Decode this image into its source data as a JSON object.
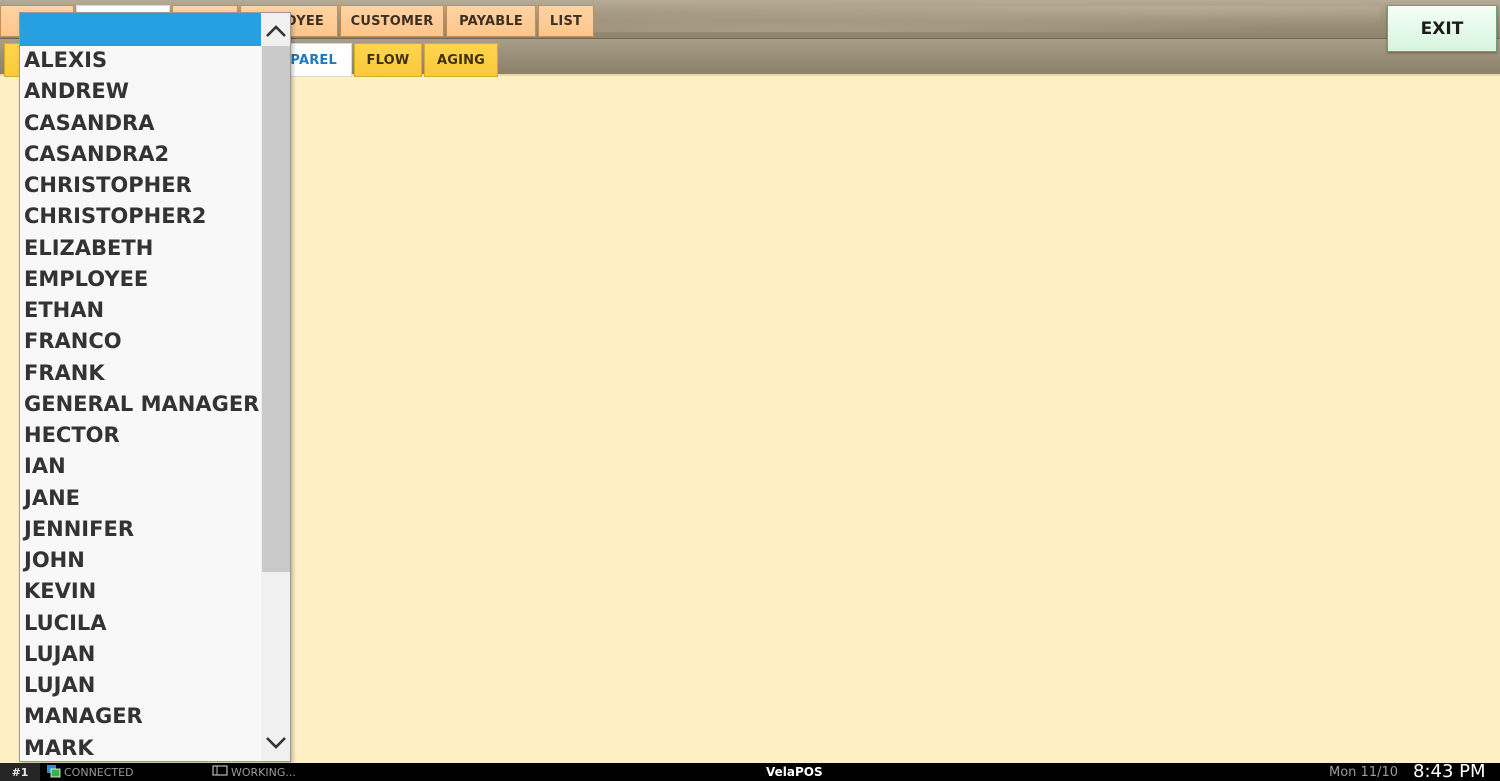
{
  "top_tabs": [
    "",
    "",
    "",
    "OYEE",
    "CUSTOMER",
    "PAYABLE",
    "LIST"
  ],
  "sub_tabs": [
    "PPAREL",
    "FLOW",
    "AGING"
  ],
  "exit_label": "EXIT",
  "dropdown": {
    "selected": "",
    "items": [
      "ALEXIS",
      "ANDREW",
      "CASANDRA",
      "CASANDRA2",
      "CHRISTOPHER",
      "CHRISTOPHER2",
      "ELIZABETH",
      "EMPLOYEE",
      "ETHAN",
      "FRANCO",
      "FRANK",
      "GENERAL MANAGER",
      "HECTOR",
      "IAN",
      "JANE",
      "JENNIFER",
      "JOHN",
      "KEVIN",
      "LUCILA",
      "LUJAN",
      "LUJAN",
      "MANAGER",
      "MARK"
    ],
    "scroll_position": 0.0,
    "visible_fraction": 0.7
  },
  "status": {
    "terminal": "#1",
    "connection": "CONNECTED",
    "activity": "WORKING...",
    "brand_prefix": "Vela",
    "brand_suffix": "POS",
    "date": "Mon 11/10",
    "time": "8:43 PM"
  },
  "colors": {
    "selection": "#26a0e0",
    "background": "#fff0c4",
    "tab": "#fdc58b",
    "subtab": "#f9c93a"
  },
  "icons": {
    "scroll_up": "chevron-up-icon",
    "scroll_down": "chevron-down-icon",
    "connected": "connected-icon",
    "working": "working-icon"
  }
}
